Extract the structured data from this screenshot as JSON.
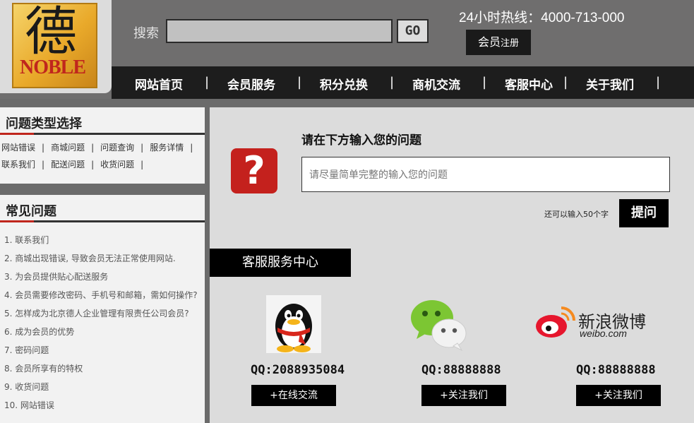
{
  "logo": {
    "glyph": "德",
    "brand": "NOBLE"
  },
  "search": {
    "label": "搜索",
    "placeholder": "",
    "go": "GO"
  },
  "hotline": "24小时热线：4000-713-000",
  "member": {
    "main": "会员",
    "small": "注册"
  },
  "nav": [
    "网站首页",
    "会员服务",
    "积分兑换",
    "商机交流",
    "客服中心",
    "关于我们"
  ],
  "sidebar": {
    "types_title": "问题类型选择",
    "types_row1": [
      "网站错误",
      "商城问题",
      "问题查询",
      "服务详情"
    ],
    "types_row2": [
      "联系我们",
      "配送问题",
      "收货问题"
    ],
    "faq_title": "常见问题",
    "faq": [
      "1. 联系我们",
      "2. 商城出现错误, 导致会员无法正常使用网站.",
      "3. 为会员提供贴心配送服务",
      "4. 会员需要修改密码、手机号和邮箱，需如何操作?",
      "5. 怎样成为北京德人企业管理有限责任公司会员?",
      "6. 成为会员的优势",
      "7. 密码问题",
      "8. 会员所享有的特权",
      "9. 收货问题",
      "10. 网站错误"
    ]
  },
  "ask": {
    "title": "请在下方输入您的问题",
    "placeholder": "请尽量简单完整的输入您的问题",
    "remain": "还可以输入50个字",
    "button": "提问"
  },
  "service": {
    "tab": "客服服务中心",
    "items": [
      {
        "icon": "qq-penguin-icon",
        "number": "QQ:2088935084",
        "button": "+在线交流"
      },
      {
        "icon": "wechat-icon",
        "number": "QQ:88888888",
        "button": "+关注我们"
      },
      {
        "icon": "weibo-icon",
        "number": "QQ:88888888",
        "button": "+关注我们",
        "brand": "新浪微博",
        "brand_sub": "weibo.com"
      }
    ]
  },
  "colors": {
    "accent": "#c0261d",
    "nav_bg": "#1d1d1d",
    "main_bg": "#dcdcdc"
  }
}
